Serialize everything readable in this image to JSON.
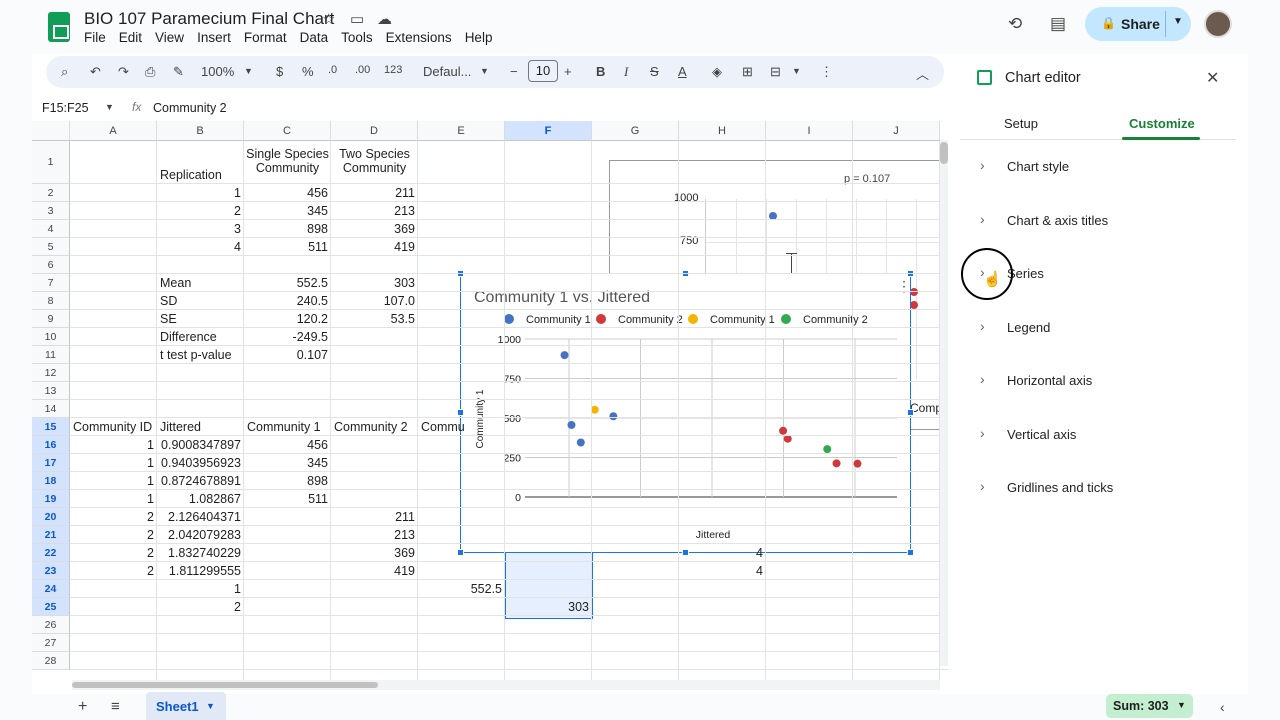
{
  "doc": {
    "title": "BIO 107 Paramecium Final Chart"
  },
  "menu": [
    "File",
    "Edit",
    "View",
    "Insert",
    "Format",
    "Data",
    "Tools",
    "Extensions",
    "Help"
  ],
  "header": {
    "share_label": "Share"
  },
  "toolbar": {
    "zoom": "100%",
    "currency": "$",
    "percent": "%",
    "dec_decrease": ".0",
    "dec_increase": ".00",
    "num_format": "123",
    "font": "Defaul...",
    "font_size": "10"
  },
  "formula": {
    "namebox": "F15:F25",
    "fx": "fx",
    "value": "Community 2"
  },
  "columns": [
    "A",
    "B",
    "C",
    "D",
    "E",
    "F",
    "G",
    "H",
    "I",
    "J"
  ],
  "rows": [
    "1",
    "2",
    "3",
    "4",
    "5",
    "6",
    "7",
    "8",
    "9",
    "10",
    "11",
    "12",
    "13",
    "14",
    "15",
    "16",
    "17",
    "18",
    "19",
    "20",
    "21",
    "22",
    "23",
    "24",
    "25",
    "26",
    "27",
    "28"
  ],
  "cells": {
    "b1": "Replication",
    "c1a": "Single Species",
    "c1b": "Community",
    "d1a": "Two Species",
    "d1b": "Community",
    "b2": "1",
    "c2": "456",
    "d2": "211",
    "b3": "2",
    "c3": "345",
    "d3": "213",
    "b4": "3",
    "c4": "898",
    "d4": "369",
    "b5": "4",
    "c5": "511",
    "d5": "419",
    "b7": "Mean",
    "c7": "552.5",
    "d7": "303",
    "b8": "SD",
    "c8": "240.5",
    "d8": "107.0",
    "b9": "SE",
    "c9": "120.2",
    "d9": "53.5",
    "b10": "Difference",
    "c10": "-249.5",
    "b11": "t test p-value",
    "c11": "0.107",
    "a15": "Community ID",
    "b15": "Jittered",
    "c15": "Community 1",
    "d15": "Community 2",
    "e15": "Commu",
    "a16": "1",
    "b16": "0.9008347897",
    "c16": "456",
    "a17": "1",
    "b17": "0.9403956923",
    "c17": "345",
    "a18": "1",
    "b18": "0.8724678891",
    "c18": "898",
    "a19": "1",
    "b19": "1.082867",
    "c19": "511",
    "a20": "2",
    "b20": "2.126404371",
    "d20": "211",
    "a21": "2",
    "b21": "2.042079283",
    "d21": "213",
    "a22": "2",
    "b22": "1.832740229",
    "d22": "369",
    "h22": "4",
    "a23": "2",
    "b23": "1.811299555",
    "d23": "419",
    "h23": "4",
    "b24": "1",
    "e24": "552.5",
    "b25": "2",
    "f25": "303"
  },
  "bg_chart": {
    "annotation": "p = 0.107",
    "yticks": [
      "1000",
      "750"
    ],
    "partial_label": "Comp"
  },
  "chart_data": {
    "type": "scatter",
    "title": "Community 1 vs. Jittered",
    "xlabel": "Jittered",
    "ylabel": "Community 1",
    "ylim": [
      0,
      1000
    ],
    "yticks": [
      "1000",
      "750",
      "500",
      "250",
      "0"
    ],
    "legend_position": "top",
    "series": [
      {
        "name": "Community 1",
        "color": "#4472c4",
        "points": [
          [
            0.9,
            456
          ],
          [
            0.94,
            345
          ],
          [
            0.87,
            898
          ],
          [
            1.08,
            511
          ]
        ]
      },
      {
        "name": "Community 2",
        "color": "#d0393b",
        "points": [
          [
            2.13,
            211
          ],
          [
            2.04,
            213
          ],
          [
            1.83,
            369
          ],
          [
            1.81,
            419
          ]
        ]
      },
      {
        "name": "Community 1",
        "color": "#f4b400",
        "points": [
          [
            1.0,
            552.5
          ]
        ]
      },
      {
        "name": "Community 2",
        "color": "#34a853",
        "points": [
          [
            2.0,
            303
          ]
        ]
      }
    ]
  },
  "editor": {
    "title": "Chart editor",
    "tabs": [
      "Setup",
      "Customize"
    ],
    "sections": [
      "Chart style",
      "Chart & axis titles",
      "Series",
      "Legend",
      "Horizontal axis",
      "Vertical axis",
      "Gridlines and ticks"
    ]
  },
  "footer": {
    "sheet": "Sheet1",
    "sum": "Sum: 303"
  }
}
